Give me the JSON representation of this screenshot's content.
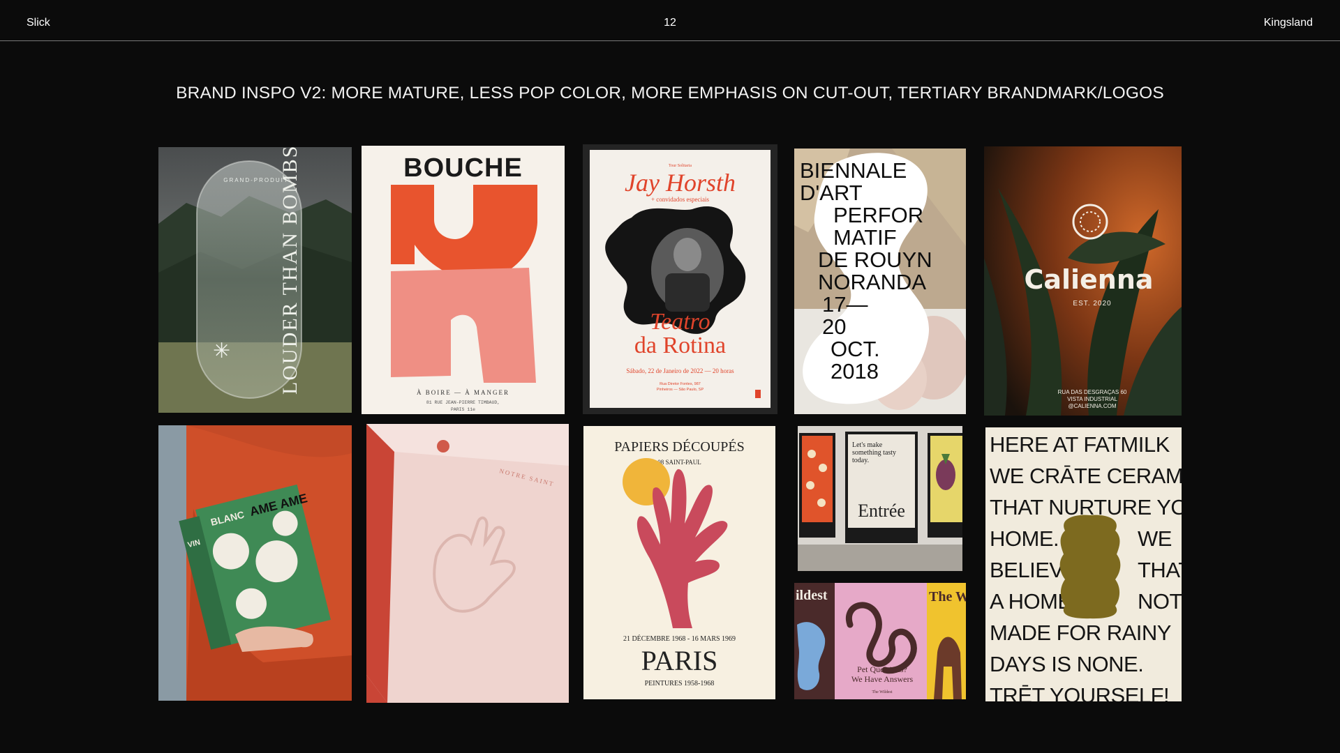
{
  "header": {
    "left": "Slick",
    "page_number": "12",
    "right": "Kingsland"
  },
  "slide": {
    "title": "BRAND INSPO V2: MORE MATURE, LESS POP COLOR, MORE EMPHASIS ON CUT-OUT, TERTIARY BRANDMARK/LOGOS"
  },
  "tiles": {
    "louder": {
      "vertical_text": "LOUDER THAN BOMBS",
      "small_text": "GRAND-PRODUIT"
    },
    "bouche": {
      "title": "BOUCHE",
      "line1": "À BOIRE — À MANGER",
      "line2": "81 RUE JEAN-PIERRE TIMBAUD,",
      "line3": "PARIS 11e"
    },
    "jay": {
      "top_small": "Tour Solitaria",
      "name": "Jay Horsth",
      "sub": "+ convidados especiais",
      "venue1": "Teatro",
      "venue2": "da Rotina",
      "date": "Sábado, 22 de Janeiro de 2022 — 20 horas",
      "address1": "Rua Diretor Fontes, 987",
      "address2": "Pinheiros — São Paulo, SP"
    },
    "biennale": {
      "lines": [
        "BIENNALE",
        "D'ART",
        "PERFOR",
        "MATIF",
        "DE ROUYN",
        "NORANDA",
        "17—",
        "20",
        "OCT.",
        "2018"
      ]
    },
    "calienna": {
      "name": "Calienna",
      "est": "EST. 2020",
      "footer1": "RUA DAS DESGRAÇAS 60",
      "footer2": "VISTA INDUSTRIAL",
      "footer3": "@CALIENNA.COM"
    },
    "ameame": {
      "brand": "AME AME",
      "label": "BLANC",
      "side": "VIN"
    },
    "pinkbox": {
      "side_text": "NOTRE SAINT"
    },
    "papiers": {
      "title": "PAPIERS DÉCOUPÉS",
      "sub": "08 SAINT-PAUL",
      "dates": "21 DÉCEMBRE 1968 - 16 MARS 1969",
      "city": "PARIS",
      "years": "PEINTURES 1958-1968"
    },
    "entree": {
      "tagline1": "Let's make",
      "tagline2": "something tasty",
      "tagline3": "today.",
      "brand": "Entrée"
    },
    "wildest": {
      "left_word": "ildest",
      "right_word": "The W",
      "q1": "Pet Questions?",
      "q2": "We Have Answers",
      "foot": "The Wildest"
    },
    "fatmilk": {
      "lines": [
        "HERE AT FATMILK",
        "WE CRĀTE CERAMICS",
        "THAT NURTURE YOR",
        "HOME.",
        "BELIEVE",
        "A HOME",
        "MADE FOR RAINY",
        "DAYS IS NONE.",
        "TRĒT YOURSELF!"
      ],
      "right1": "WE",
      "right2": "THAT",
      "right3": "NOT"
    }
  },
  "colors": {
    "background": "#0b0b0b",
    "divider": "#7a7a7a",
    "bouche_orange": "#e8542e",
    "bouche_pink": "#ef8f84",
    "jay_red": "#e0442b",
    "papiers_red": "#c94a5c",
    "papiers_yellow": "#f0b53a",
    "calienna_orange": "#b5541e",
    "fatmilk_olive": "#7d6a1f"
  }
}
